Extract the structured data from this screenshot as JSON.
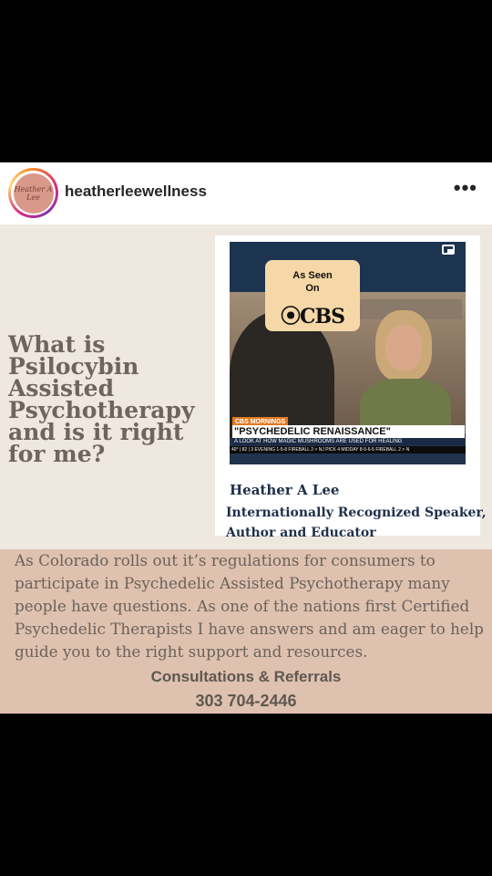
{
  "header": {
    "username": "heatherleewellness",
    "avatar_text": "Heather A Lee",
    "more_icon": "more-horizontal-icon"
  },
  "post": {
    "headline": "What is Psilocybin Assisted Psychotherapy and is it right for me?",
    "video": {
      "badge_line1": "As Seen",
      "badge_line2": "On",
      "badge_logo": "⦿CBS",
      "chyron_tag": "CBS MORNINGS",
      "chyron_title": "\"PSYCHEDELIC RENAISSANCE\"",
      "chyron_subtitle": "A LOOK AT HOW MAGIC MUSHROOMS ARE USED FOR HEALING",
      "ticker": "40° | 82 | 3 EVENING 1-5-8 FIREBALL 2 > NJ PICK 4 MIDDAY 8-5-6-5 FIREBALL 2 > N",
      "pip_icon": "picture-in-picture-icon"
    },
    "card_name": "Heather A Lee",
    "card_title_line1": "Internationally Recognized Speaker,",
    "card_title_line2": "Author and Educator",
    "body": "As Colorado rolls out it’s regulations for consumers to participate in Psychedelic Assisted Psychotherapy many people have questions. As one of the nations first Certified Psychedelic Therapists I have answers and am eager to help guide you to the right support and resources.",
    "cta_label": "Consultations & Referrals",
    "cta_phone": "303 704-2446"
  },
  "colors": {
    "post_background": "#efe8e0",
    "bottom_band": "#dfc1af",
    "headline_text": "#6e655c",
    "card_text": "#1f2f4a"
  }
}
